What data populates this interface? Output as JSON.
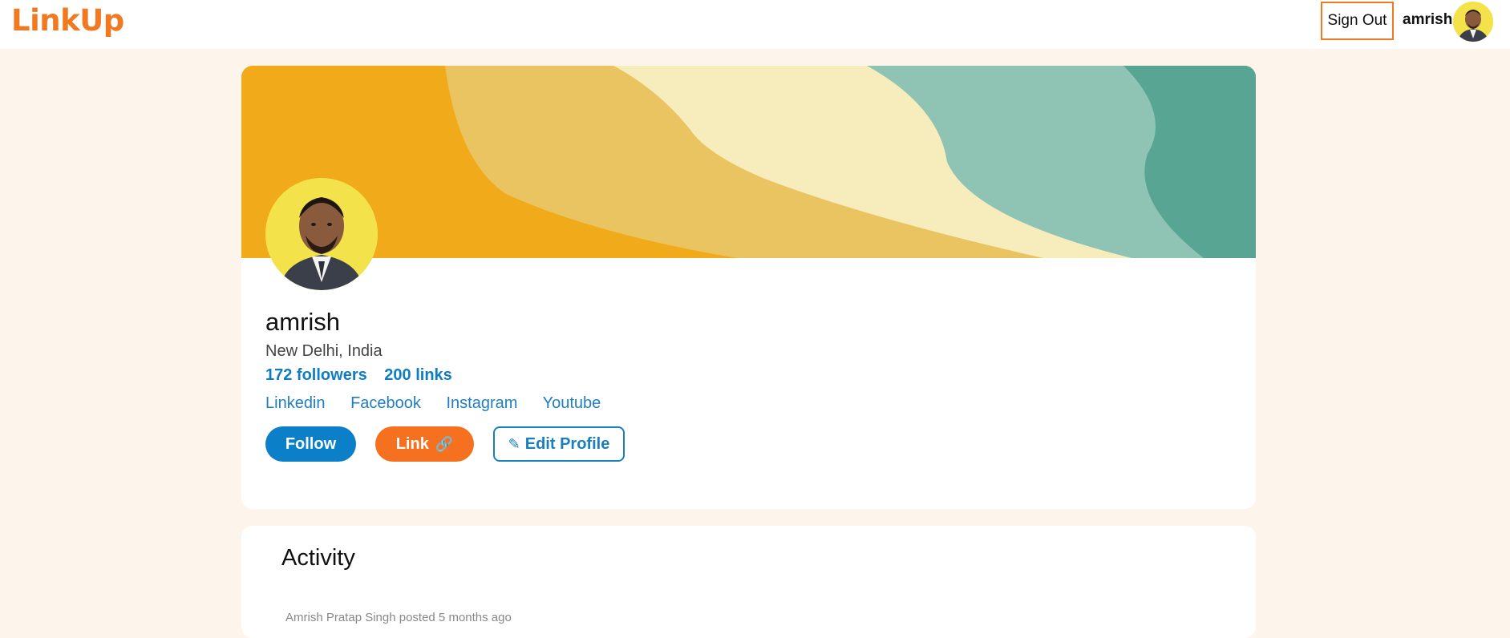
{
  "header": {
    "logo": "LinkUp",
    "sign_out_label": "Sign Out",
    "username": "amrish"
  },
  "profile": {
    "name": "amrish",
    "location": "New Delhi, India",
    "followers": "172 followers",
    "links_count": "200 links",
    "social_links": [
      "Linkedin",
      "Facebook",
      "Instagram",
      "Youtube"
    ],
    "follow_label": "Follow",
    "link_label": "Link",
    "edit_label": "Edit Profile"
  },
  "activity": {
    "title": "Activity",
    "post_meta": "Amrish Pratap Singh posted 5 months ago"
  },
  "colors": {
    "brand_orange": "#f07a22",
    "primary_blue": "#0b7fc7",
    "background": "#fdf4ec"
  },
  "icons": {
    "link_button_icon": "chain-link-icon",
    "edit_button_icon": "pencil-icon"
  }
}
